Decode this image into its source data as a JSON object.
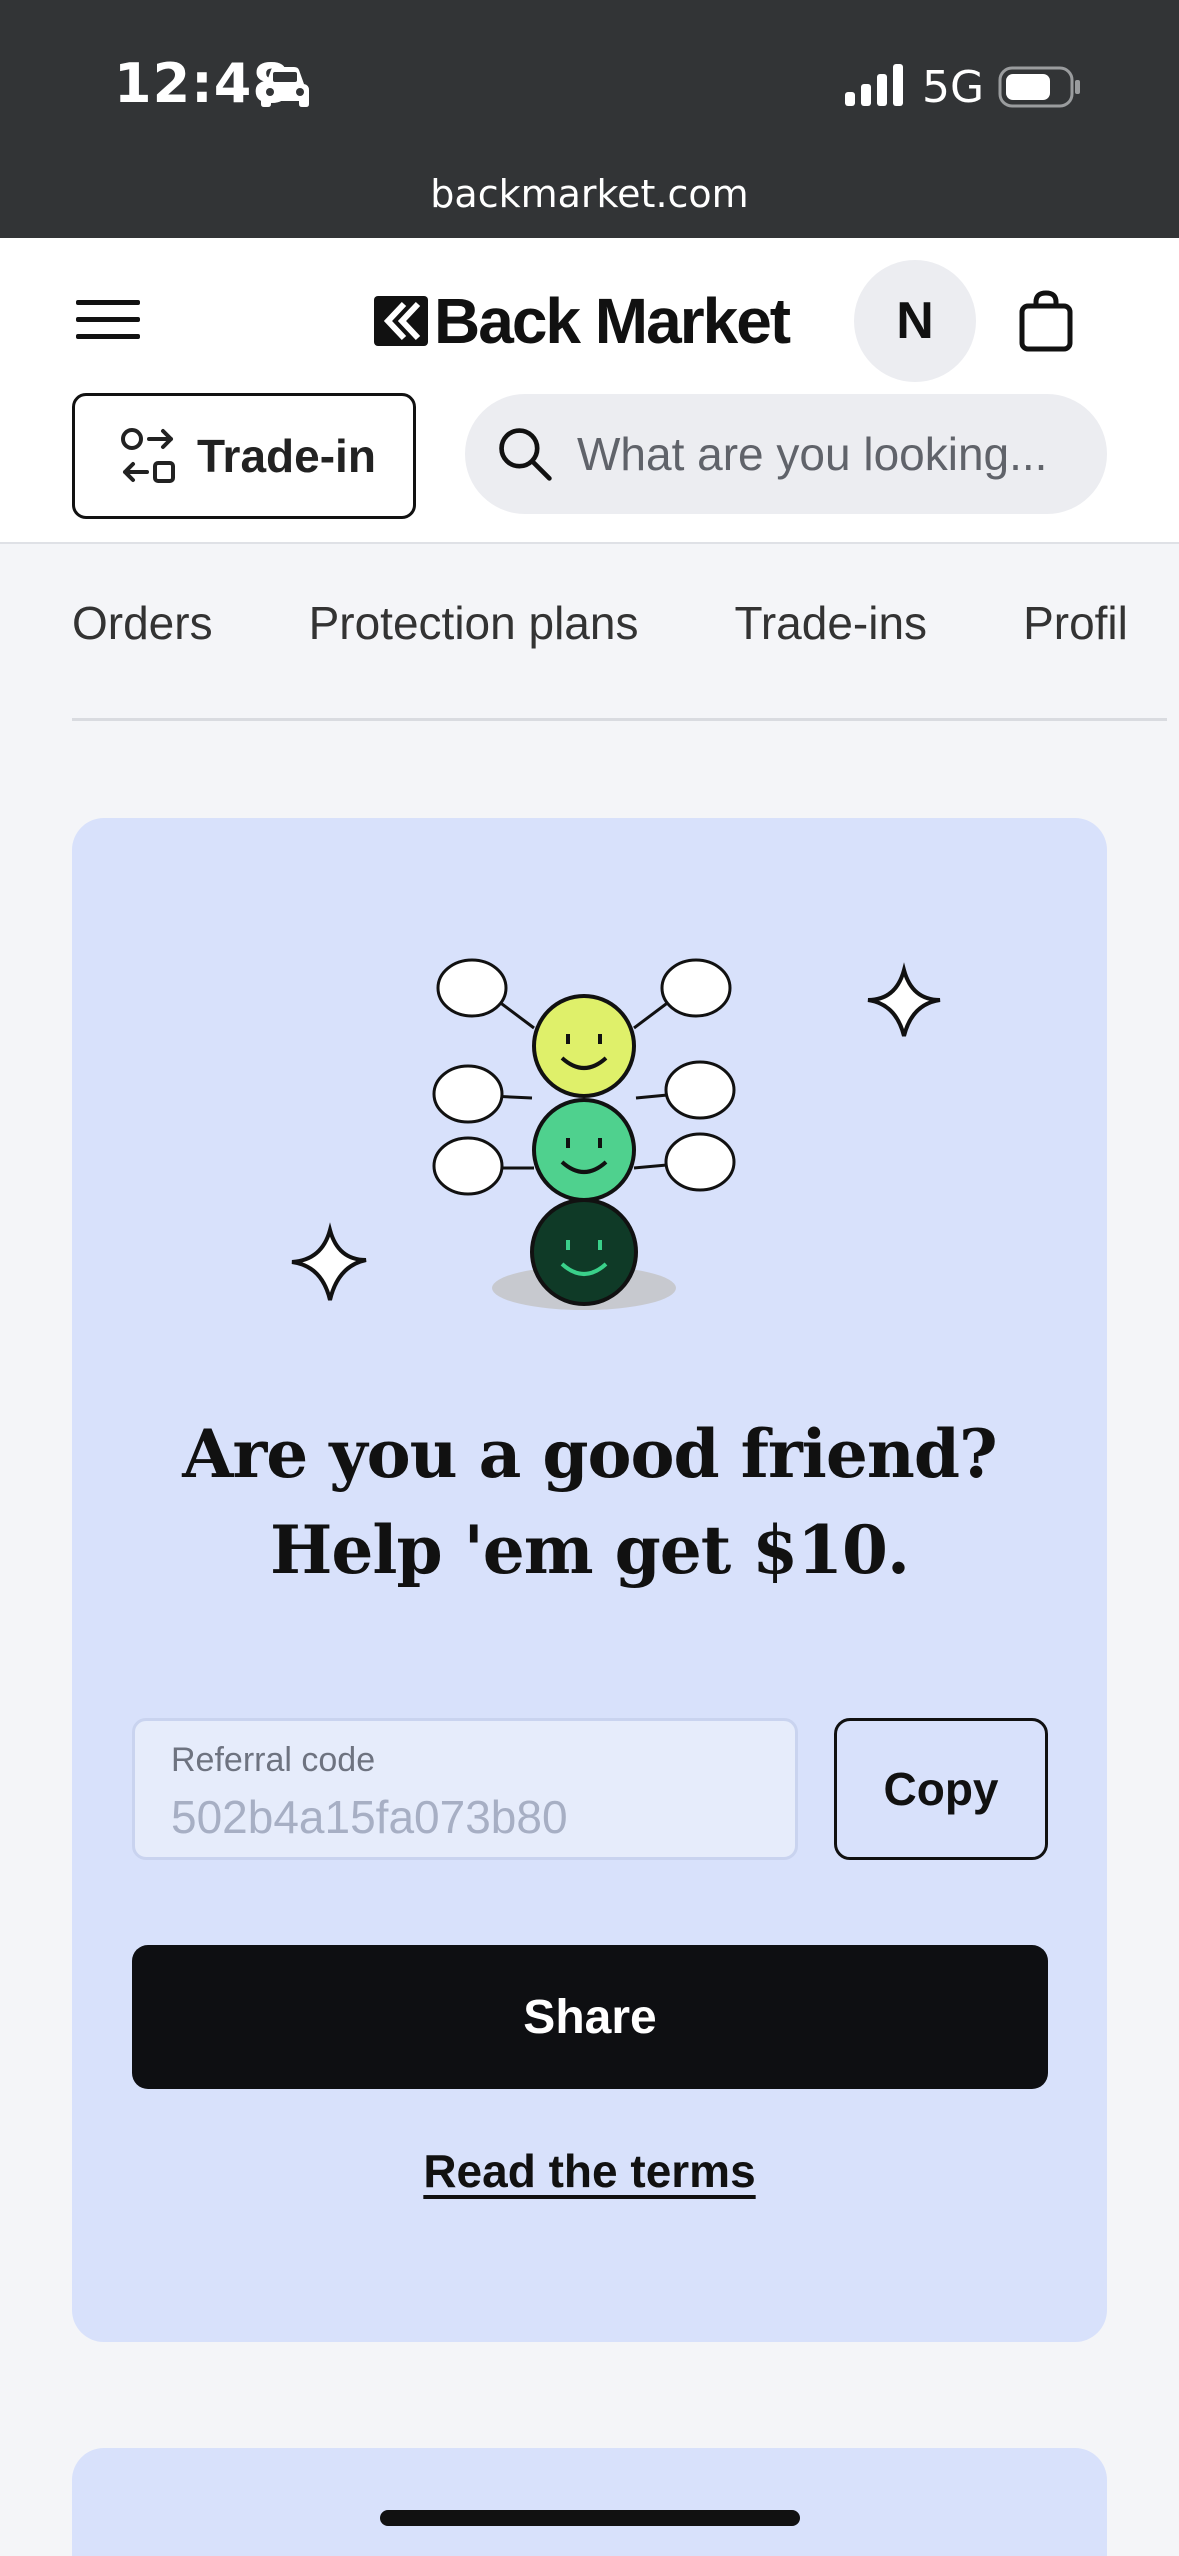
{
  "status_bar": {
    "time": "12:48",
    "network": "5G",
    "url": "backmarket.com"
  },
  "header": {
    "logo_text": "Back Market",
    "avatar_initial": "N",
    "trade_in_label": "Trade-in",
    "search_placeholder": "What are you looking..."
  },
  "tabs": [
    "Orders",
    "Protection plans",
    "Trade-ins",
    "Profil"
  ],
  "referral": {
    "headline_line1": "Are you a good friend?",
    "headline_line2": "Help 'em get $10.",
    "code_label": "Referral code",
    "code_value": "502b4a15fa073b80",
    "copy_label": "Copy",
    "share_label": "Share",
    "terms_label": "Read the terms"
  },
  "colors": {
    "card_bg": "#d8e1fb",
    "share_bg": "#0e0f12",
    "status_bar_bg": "#323436"
  },
  "icons": [
    "car-icon",
    "signal-icon",
    "battery-icon",
    "menu-icon",
    "back-market-logo",
    "bag-icon",
    "trade-in-icon",
    "search-icon",
    "sparkle-icon",
    "smiley-illustration"
  ]
}
